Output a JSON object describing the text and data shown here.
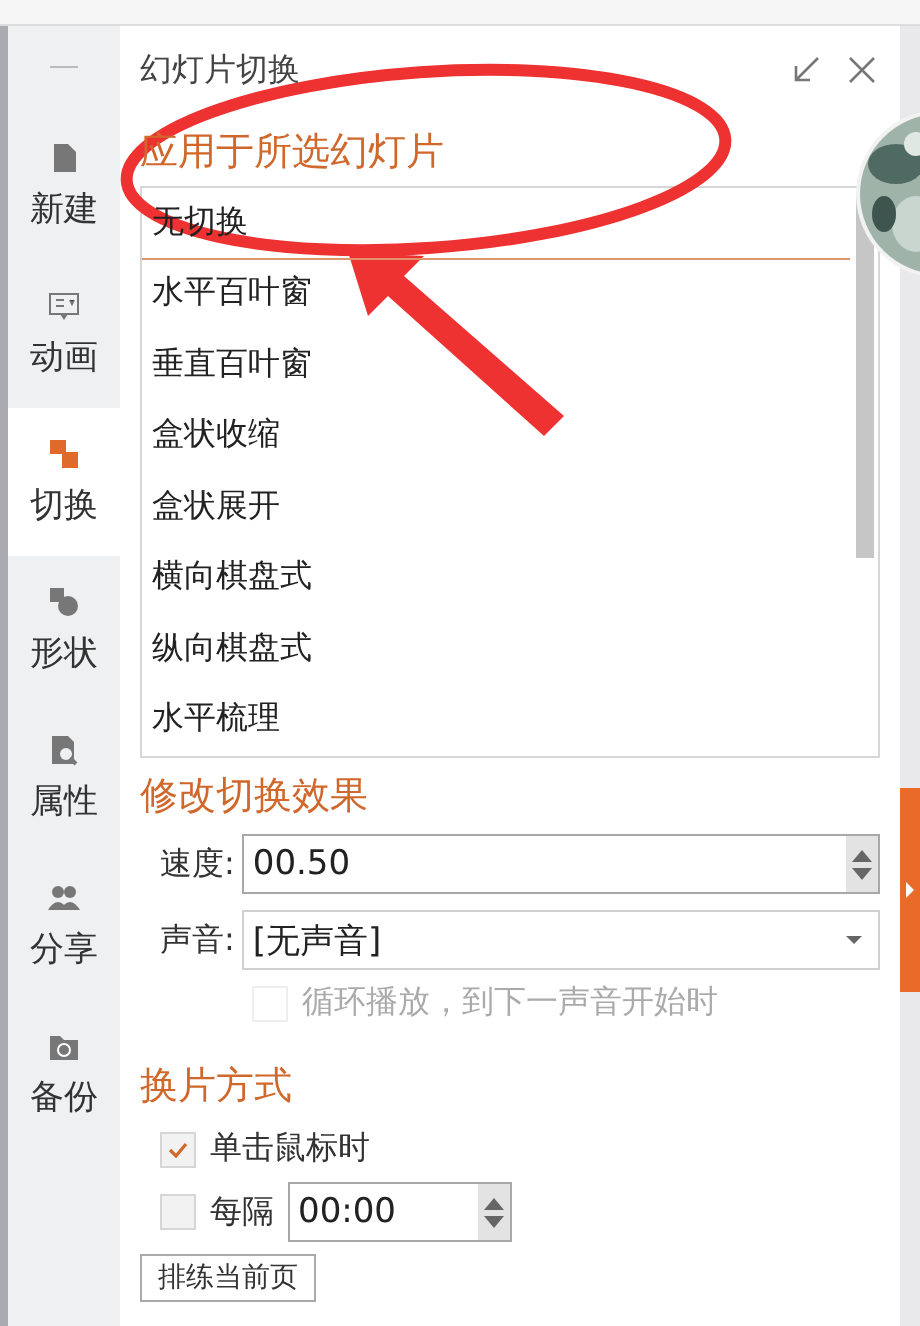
{
  "sidebar": {
    "items": [
      {
        "label": "新建",
        "kind": "new",
        "selected": false
      },
      {
        "label": "动画",
        "kind": "animation",
        "selected": false
      },
      {
        "label": "切换",
        "kind": "transition",
        "selected": true
      },
      {
        "label": "形状",
        "kind": "shape",
        "selected": false
      },
      {
        "label": "属性",
        "kind": "property",
        "selected": false
      },
      {
        "label": "分享",
        "kind": "share",
        "selected": false
      },
      {
        "label": "备份",
        "kind": "backup",
        "selected": false
      }
    ]
  },
  "panel": {
    "title": "幻灯片切换",
    "apply_heading": "应用于所选幻灯片",
    "transitions": [
      {
        "label": "无切换",
        "selected": true
      },
      {
        "label": "水平百叶窗",
        "selected": false
      },
      {
        "label": "垂直百叶窗",
        "selected": false
      },
      {
        "label": "盒状收缩",
        "selected": false
      },
      {
        "label": "盒状展开",
        "selected": false
      },
      {
        "label": "横向棋盘式",
        "selected": false
      },
      {
        "label": "纵向棋盘式",
        "selected": false
      },
      {
        "label": "水平梳理",
        "selected": false
      }
    ],
    "effect_heading": "修改切换效果",
    "speed": {
      "label": "速度:",
      "value": "00.50"
    },
    "sound": {
      "label": "声音:",
      "value": "[无声音]"
    },
    "loop": {
      "label": "循环播放，到下一声音开始时",
      "checked": false,
      "disabled": true
    },
    "advance_heading": "换片方式",
    "on_click": {
      "label": "单击鼠标时",
      "checked": true
    },
    "every": {
      "label": "每隔",
      "checked": false,
      "value": "00:00"
    },
    "rehearse_button": "排练当前页"
  }
}
